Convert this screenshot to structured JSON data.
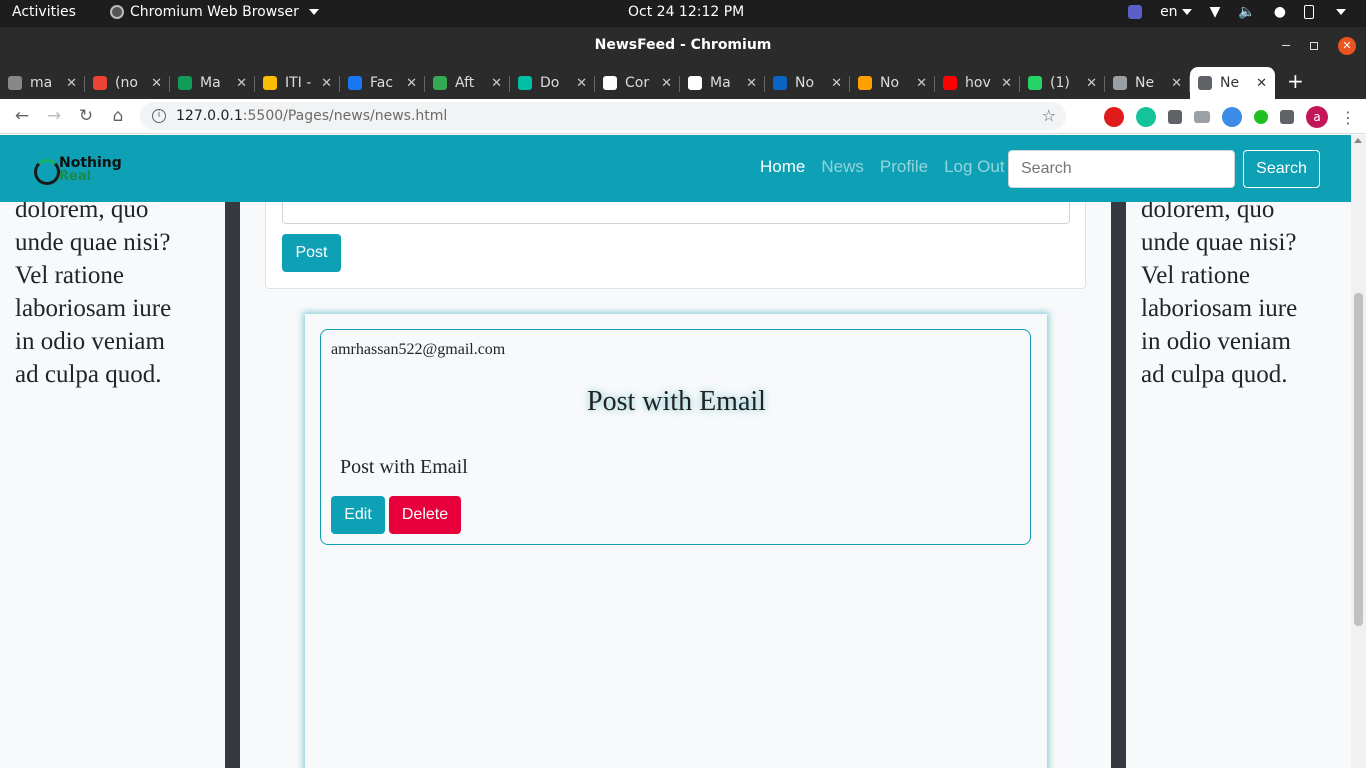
{
  "os_bar": {
    "activities": "Activities",
    "app_name": "Chromium Web Browser",
    "clock": "Oct 24  12:12 PM",
    "lang": "en"
  },
  "window": {
    "title": "NewsFeed - Chromium"
  },
  "tabs": [
    {
      "label": "ma",
      "color": "#888888"
    },
    {
      "label": "(no",
      "color": "#ea4335"
    },
    {
      "label": "Ma",
      "color": "#0f9d58"
    },
    {
      "label": "ITI -",
      "color": "#fbbc04"
    },
    {
      "label": "Fac",
      "color": "#1877f2"
    },
    {
      "label": "Aft",
      "color": "#34a853"
    },
    {
      "label": "Do",
      "color": "#00bfa5"
    },
    {
      "label": "Cor",
      "color": "#ffffff"
    },
    {
      "label": "Ma",
      "color": "#ffffff"
    },
    {
      "label": "No",
      "color": "#0a66c2"
    },
    {
      "label": "No",
      "color": "#ffa000"
    },
    {
      "label": "hov",
      "color": "#ff0000"
    },
    {
      "label": "(1)",
      "color": "#25d366"
    },
    {
      "label": "Ne",
      "color": "#9aa0a6"
    },
    {
      "label": "Ne",
      "color": "#5f6368"
    }
  ],
  "address": {
    "host": "127.0.0.1",
    "path": ":5500/Pages/news/news.html"
  },
  "navbar": {
    "logo_line1": "Nothing",
    "logo_line2": "Real",
    "links": [
      "Home",
      "News",
      "Profile",
      "Log Out"
    ],
    "search_placeholder": "Search",
    "search_button": "Search"
  },
  "side_text": {
    "lines": [
      "dolorem, quo",
      "unde quae nisi?",
      "Vel ratione",
      "laboriosam iure",
      "in odio veniam",
      "ad culpa quod."
    ]
  },
  "form": {
    "post_button": "Post"
  },
  "post": {
    "email": "amrhassan522@gmail.com",
    "title": "Post with Email",
    "body": "Post with Email",
    "edit_label": "Edit",
    "delete_label": "Delete"
  },
  "colors": {
    "brand": "#0ea0b4",
    "danger": "#e8003c"
  }
}
